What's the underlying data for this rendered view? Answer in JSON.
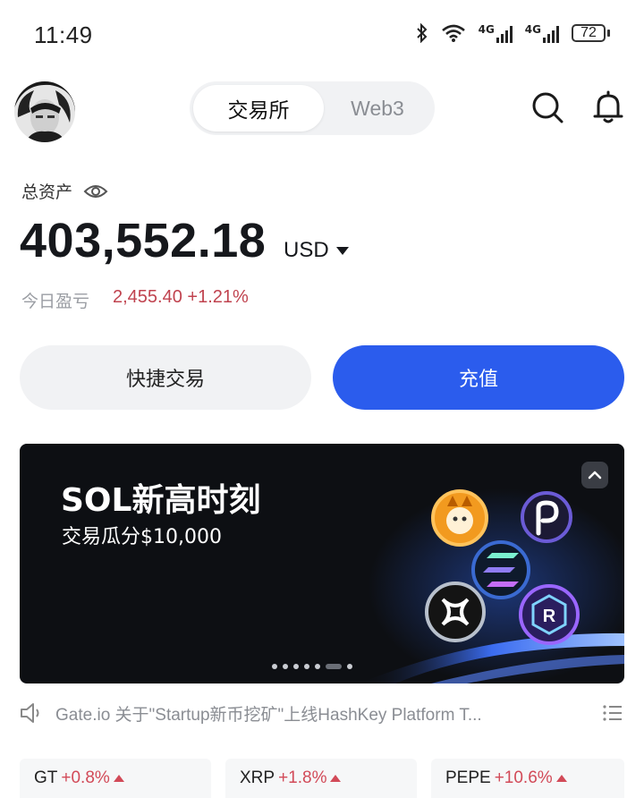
{
  "status_bar": {
    "time": "11:49",
    "network_1": "4G",
    "network_2": "4G",
    "battery": "72",
    "icons": [
      "bluetooth-icon",
      "wifi-icon",
      "signal-icon",
      "battery-icon"
    ]
  },
  "header": {
    "avatar": "user-avatar",
    "tabs": [
      {
        "label": "交易所",
        "active": true
      },
      {
        "label": "Web3",
        "active": false
      }
    ],
    "icons": [
      "search-icon",
      "bell-icon"
    ]
  },
  "assets": {
    "label": "总资产",
    "balance": "403,552.18",
    "currency": "USD",
    "pnl_label": "今日盈亏",
    "pnl_value": "2,455.40 +1.21%"
  },
  "actions": {
    "quick_trade": "快捷交易",
    "deposit": "充值"
  },
  "banner": {
    "title": "SOL新高时刻",
    "subtitle": "交易瓜分$10,000",
    "slide_count": 7,
    "active_slide": 5
  },
  "notice": {
    "text": "Gate.io 关于\"Startup新币挖矿\"上线HashKey Platform T..."
  },
  "tickers": [
    {
      "symbol": "GT",
      "change": "+0.8%"
    },
    {
      "symbol": "XRP",
      "change": "+1.8%"
    },
    {
      "symbol": "PEPE",
      "change": "+10.6%"
    }
  ],
  "colors": {
    "accent": "#2b5ced",
    "positive": "#d24a58",
    "banner_bg": "#0d0f13"
  }
}
